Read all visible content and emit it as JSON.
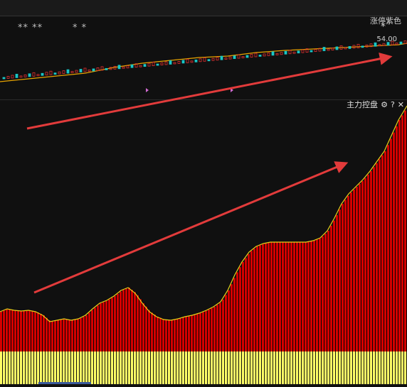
{
  "header": {
    "stars_left": "** **",
    "stars_right": "*  *",
    "label_top_right": "涨停紫色",
    "mark": "*",
    "price_tag": "54.00"
  },
  "indicator": {
    "title": "主力控盘",
    "icons": [
      "gear-icon",
      "help-icon",
      "close-icon"
    ],
    "icon_glyphs": {
      "gear": "⚙",
      "help": "?",
      "close": "✕"
    }
  },
  "colors": {
    "background": "#101010",
    "bar_red": "#d40000",
    "bar_black": "#050505",
    "outline_yellow": "#e8d21a",
    "bottom_yellow": "#ffff66",
    "arrow_red": "#e23b3b"
  }
}
